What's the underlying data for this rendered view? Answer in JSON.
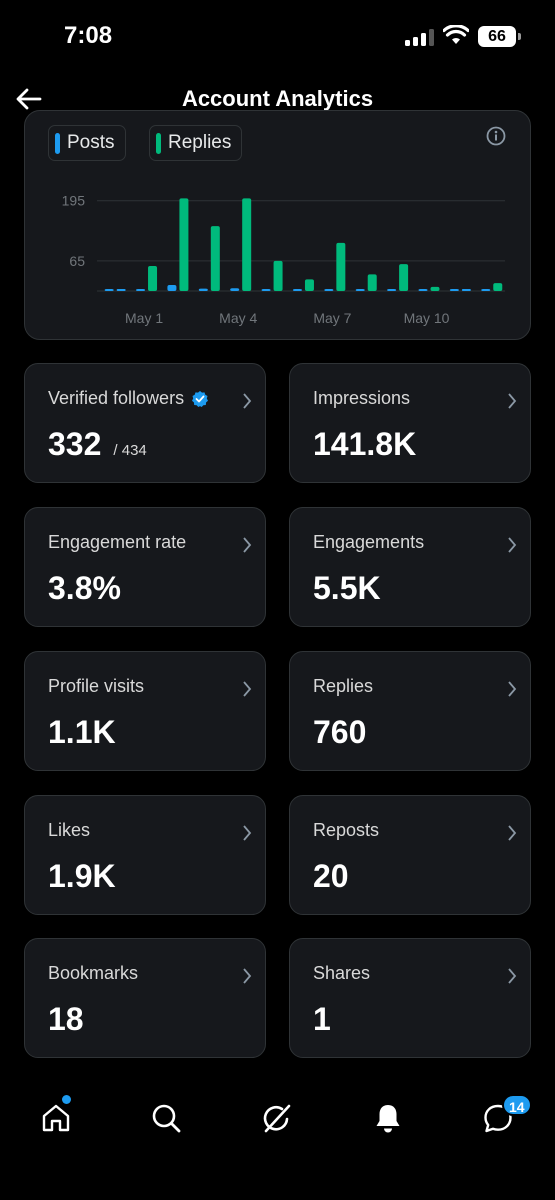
{
  "status_bar": {
    "time": "7:08",
    "battery": "66"
  },
  "header": {
    "title": "Account Analytics"
  },
  "colors": {
    "posts": "#1d9bf0",
    "replies": "#00ba7c",
    "accent": "#1d9bf0"
  },
  "legend": [
    {
      "label": "Posts",
      "color": "#1d9bf0"
    },
    {
      "label": "Replies",
      "color": "#00ba7c"
    }
  ],
  "chart_data": {
    "type": "bar",
    "x_tick_labels": [
      "May 1",
      "May 4",
      "May 7",
      "May 10"
    ],
    "y_tick_labels": [
      "195",
      "65"
    ],
    "ylim": [
      0,
      216
    ],
    "categories": [
      "Apr 30",
      "May 1",
      "May 2",
      "May 3",
      "May 4",
      "May 5",
      "May 6",
      "May 7",
      "May 8",
      "May 9",
      "May 10",
      "May 11",
      "May 12"
    ],
    "series": [
      {
        "name": "Posts",
        "values": [
          4,
          3,
          13,
          5,
          6,
          3,
          2,
          4,
          3,
          2,
          1,
          0,
          0
        ]
      },
      {
        "name": "Replies",
        "values": [
          0,
          54,
          200,
          140,
          200,
          65,
          25,
          104,
          36,
          58,
          9,
          0,
          17
        ]
      }
    ]
  },
  "tiles": [
    {
      "label": "Verified followers",
      "value": "332",
      "sub": "/ 434"
    },
    {
      "label": "Impressions",
      "value": "141.8K"
    },
    {
      "label": "Engagement rate",
      "value": "3.8%"
    },
    {
      "label": "Engagements",
      "value": "5.5K"
    },
    {
      "label": "Profile visits",
      "value": "1.1K"
    },
    {
      "label": "Replies",
      "value": "760"
    },
    {
      "label": "Likes",
      "value": "1.9K"
    },
    {
      "label": "Reposts",
      "value": "20"
    },
    {
      "label": "Bookmarks",
      "value": "18"
    },
    {
      "label": "Shares",
      "value": "1"
    }
  ],
  "bottom_nav": {
    "items": [
      "home-icon",
      "search-icon",
      "grok-icon",
      "notifications-icon",
      "messages-icon"
    ],
    "messages_badge": "14"
  }
}
